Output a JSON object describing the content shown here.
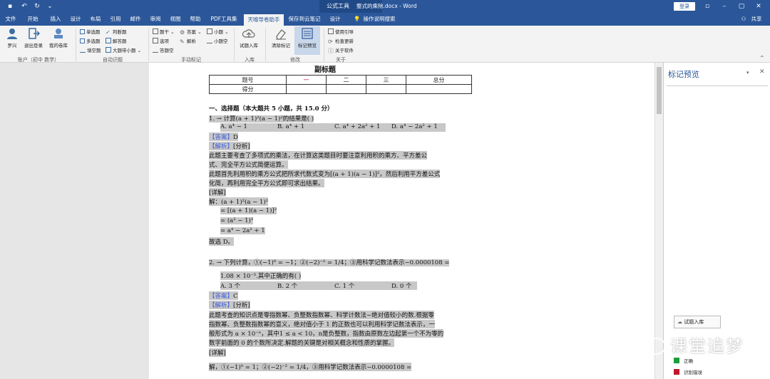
{
  "titlebar": {
    "doc_title": "整式的乘除.docx - Word",
    "ctx_group": "公式工具",
    "login": "登录"
  },
  "tabs": [
    "文件",
    "开始",
    "插入",
    "设计",
    "布局",
    "引用",
    "邮件",
    "审阅",
    "视图",
    "帮助",
    "PDF工具集",
    "天喻导卷助手",
    "保存到云笔记",
    "设计"
  ],
  "active_tab": "天喻导卷助手",
  "tell_me": "操作说明搜索",
  "share": "共享",
  "ribbon": {
    "account": {
      "user_btn": "罗兴",
      "logout_btn": "退出登录",
      "mybank_btn": "我的卷库",
      "group": "账户（初中 数学）"
    },
    "auto_mark": {
      "items": [
        "单选题",
        "判断题",
        "多选题",
        "解答题",
        "填空题",
        "大题带小题"
      ],
      "group": "自动识题"
    },
    "manual_mark": {
      "items": [
        "题干",
        "答案",
        "小题",
        "选项",
        "解析",
        "小题空",
        "答题空"
      ],
      "group": "手动标记"
    },
    "import": {
      "btn": "试题入库",
      "group": "入库"
    },
    "modify": {
      "clear_btn": "清除标记",
      "preview_btn": "标记预览",
      "group": "修改"
    },
    "about": {
      "items": [
        "使用引导",
        "检查更新",
        "关于软件"
      ],
      "group": "关于"
    }
  },
  "doc": {
    "subtitle": "副标题",
    "score_table": {
      "row1": [
        "题号",
        "一",
        "二",
        "三",
        "总分"
      ],
      "row2": [
        "得分",
        "",
        "",
        "",
        ""
      ]
    },
    "section": "一、选择题（本大题共 5 小题，共 15.0 分）",
    "q1": {
      "stem": "1. → 计算(a + 1)²(a − 1)²的结果是(    )",
      "opts": [
        "A. a⁴ − 1",
        "B. a⁴ + 1",
        "C. a⁴ + 2a² + 1",
        "D. a⁴ − 2a² + 1"
      ],
      "answer_tag": "【答案】",
      "answer": "D",
      "analysis_tag": "【解析】",
      "analysis_head": "[分析]",
      "lines": [
        "此题主要考查了多项式的乘法，在计算这类题目时要注意利用积的乘方、平方差公",
        "式、完全平方公式简便运算。",
        "此题首先利用积的乘方公式把所求代数式变为[(a + 1)(a − 1)]²，然后利用平方差公式",
        "化简，再利用完全平方公式即可求出结果。",
        "[详解]",
        "解：(a + 1)²(a − 1)²",
        "= [(a + 1)(a − 1)]²",
        "= (a² − 1)²",
        "= a⁴ − 2a² + 1",
        "故选 D。"
      ]
    },
    "q2": {
      "stem": "2. → 下列计算，①(−1)⁰ = −1；②(−2)⁻² = 1/4；③用科学记数法表示−0.0000108 =",
      "stem2": "1.08 × 10⁻⁵.其中正确的有(    )",
      "opts": [
        "A. 3 个",
        "B. 2 个",
        "C. 1 个",
        "D. 0 个"
      ],
      "answer_tag": "【答案】",
      "answer": "C",
      "analysis_tag": "【解析】",
      "analysis_head": "[分析]",
      "lines": [
        "此题考查的知识点是零指数幂、负整数指数幂、科学计数法−绝对值较小的数.根据零",
        "指数幂、负整数指数幂的意义，绝对值小于 1 的正数也可以利用科学记数法表示，一",
        "般形式为 a × 10⁻ⁿ，其中1 ≤ a < 10，n是负整数，指数由原数左边起第一个不为零的",
        "数字前面的 0 的个数所决定.解题的关键是对相关概念和性质的掌握。",
        "[详解]",
        "解，①(−1)⁰ = 1；②(−2)⁻² = 1/4，③用科学记数法表示−0.0000108 ="
      ]
    }
  },
  "pane": {
    "title": "标记预览",
    "import_btn": "试题入库",
    "legend": [
      {
        "label": "正确",
        "color": "#1a9e3a"
      },
      {
        "label": "识别错误",
        "color": "#c0192c"
      }
    ]
  },
  "watermark": "课堂追梦"
}
